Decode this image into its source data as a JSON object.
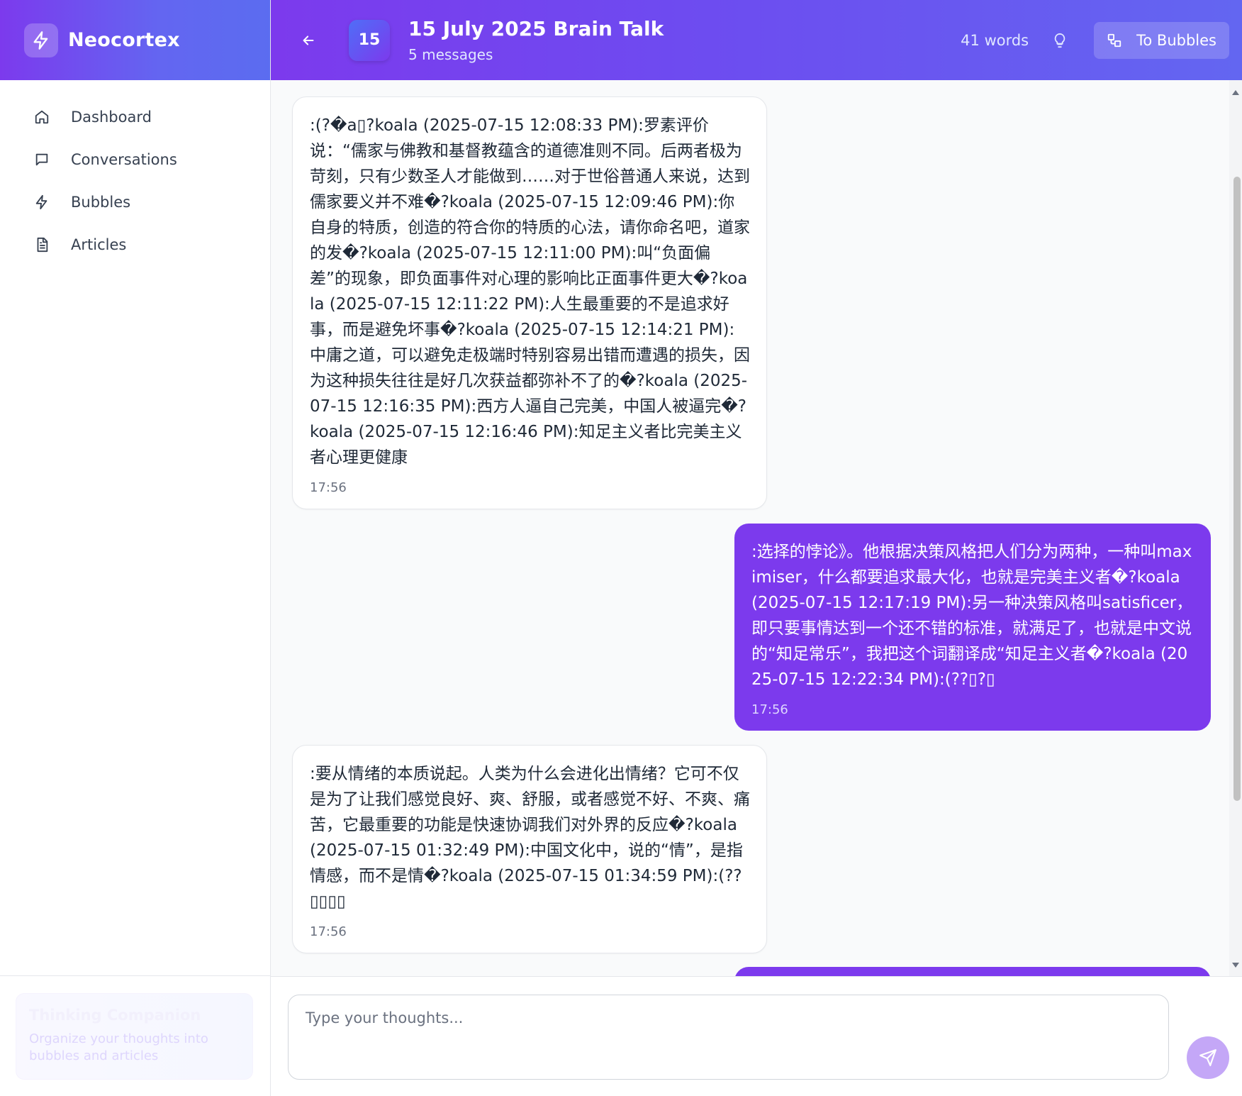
{
  "brand": {
    "name": "Neocortex",
    "logo_icon": "bolt-icon"
  },
  "sidebar": {
    "items": [
      {
        "label": "Dashboard",
        "icon": "home-icon"
      },
      {
        "label": "Conversations",
        "icon": "chat-icon"
      },
      {
        "label": "Bubbles",
        "icon": "bolt-icon"
      },
      {
        "label": "Articles",
        "icon": "document-icon"
      }
    ],
    "companion": {
      "title": "Thinking Companion",
      "subtitle": "Organize your thoughts into bubbles and articles"
    }
  },
  "header": {
    "date_badge": "15",
    "title": "15 July 2025 Brain Talk",
    "subtitle": "5 messages",
    "word_count": "41 words",
    "to_bubbles_label": "To Bubbles",
    "accent": "#7c3aed"
  },
  "messages": [
    {
      "role": "assistant",
      "text": ":(?�a▯?koala (2025-07-15 12:08:33 PM):罗素评价说：“儒家与佛教和基督教蕴含的道德准则不同。后两者极为苛刻，只有少数圣人才能做到……对于世俗普通人来说，达到儒家要义并不难�?koala (2025-07-15 12:09:46 PM):你自身的特质，创造的符合你的特质的心法，请你命名吧，道家的发�?koala (2025-07-15 12:11:00 PM):叫“负面偏差”的现象，即负面事件对心理的影响比正面事件更大�?koala (2025-07-15 12:11:22 PM):人生最重要的不是追求好事，而是避免坏事�?koala (2025-07-15 12:14:21 PM):中庸之道，可以避免走极端时特别容易出错而遭遇的损失，因为这种损失往往是好几次获益都弥补不了的�?koala (2025-07-15 12:16:35 PM):西方人逼自己完美，中国人被逼完�?koala (2025-07-15 12:16:46 PM):知足主义者比完美主义者心理更健康",
      "time": "17:56"
    },
    {
      "role": "user",
      "text": ":选择的悖论》。他根据决策风格把人们分为两种，一种叫maximiser，什么都要追求最大化，也就是完美主义者�?koala (2025-07-15 12:17:19 PM):另一种决策风格叫satisficer，即只要事情达到一个还不错的标准，就满足了，也就是中文说的“知足常乐”，我把这个词翻译成“知足主义者�?koala (2025-07-15 12:22:34 PM):(??▯?▯",
      "time": "17:56"
    },
    {
      "role": "assistant",
      "text": ":要从情绪的本质说起。人类为什么会进化出情绪？它可不仅是为了让我们感觉良好、爽、舒服，或者感觉不好、不爽、痛苦，它最重要的功能是快速协调我们对外界的反应�?koala (2025-07-15 01:32:49 PM):中国文化中，说的“情”，是指情感，而不是情�?koala (2025-07-15 01:34:59 PM):(??▯▯▯▯",
      "time": "17:56"
    }
  ],
  "composer": {
    "placeholder": "Type your thoughts...",
    "send_icon": "send-icon"
  }
}
